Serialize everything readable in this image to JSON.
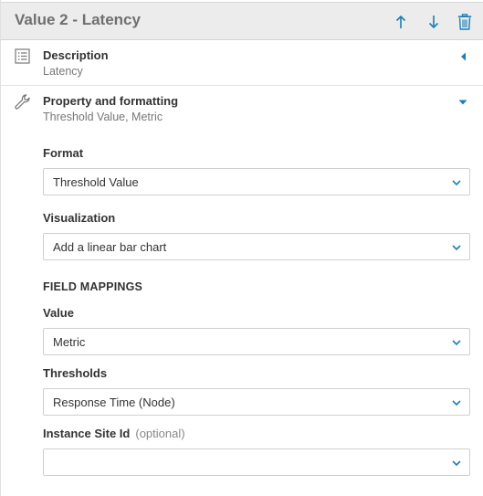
{
  "header": {
    "title": "Value 2 - Latency",
    "move_up_icon": "arrow-up-icon",
    "move_down_icon": "arrow-down-icon",
    "delete_icon": "trash-icon"
  },
  "description_section": {
    "icon": "list-icon",
    "title": "Description",
    "subtitle": "Latency",
    "toggle_icon": "caret-left-icon"
  },
  "property_section": {
    "icon": "wrench-icon",
    "title": "Property and formatting",
    "subtitle": "Threshold Value, Metric",
    "toggle_icon": "caret-down-icon",
    "format": {
      "label": "Format",
      "value": "Threshold Value"
    },
    "visualization": {
      "label": "Visualization",
      "value": "Add a linear bar chart"
    },
    "field_mappings_label": "FIELD MAPPINGS",
    "value_field": {
      "label": "Value",
      "value": "Metric"
    },
    "thresholds": {
      "label": "Thresholds",
      "value": "Response Time (Node)"
    },
    "instance_site_id": {
      "label": "Instance Site Id",
      "optional_note": "(optional)",
      "value": ""
    }
  },
  "colors": {
    "accent": "#1a7fb5",
    "header_bg": "#ececec",
    "title_gray": "#6f6f6f"
  }
}
